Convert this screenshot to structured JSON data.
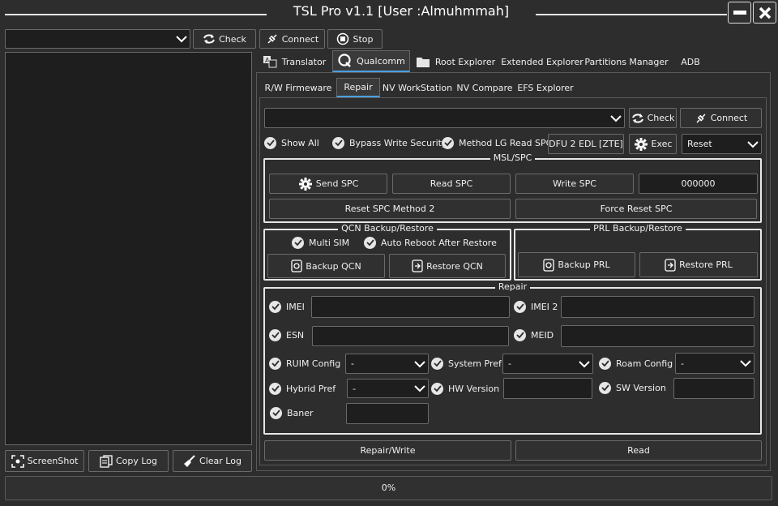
{
  "window": {
    "title": "TSL Pro v1.1 [User :Almuhmmah]"
  },
  "toolbar": {
    "check": "Check",
    "connect": "Connect",
    "stop": "Stop"
  },
  "log": {
    "screenshot": "ScreenShot",
    "copy": "Copy Log",
    "clear": "Clear Log"
  },
  "main_tabs": [
    "Translator",
    "Qualcomm",
    "Root Explorer",
    "Extended Explorer",
    "Partitions Manager",
    "ADB"
  ],
  "sub_tabs": [
    "R/W Firmeware",
    "Repair",
    "NV WorkStation",
    "NV Compare",
    "EFS Explorer"
  ],
  "repair": {
    "check": "Check",
    "connect": "Connect",
    "show_all": "Show All",
    "bypass": "Bypass Write Security",
    "method_lg": "Method LG Read SPC",
    "dfu": "DFU 2 EDL [ZTE]",
    "exec": "Exec",
    "reset_value": "Reset"
  },
  "msl": {
    "title": "MSL/SPC",
    "send": "Send SPC",
    "read": "Read SPC",
    "write": "Write SPC",
    "code": "000000",
    "reset_m2": "Reset SPC Method 2",
    "force_reset": "Force Reset SPC"
  },
  "qcn": {
    "title": "QCN Backup/Restore",
    "multi_sim": "Multi SIM",
    "auto_reboot": "Auto Reboot After Restore",
    "backup": "Backup QCN",
    "restore": "Restore QCN"
  },
  "prl": {
    "title": "PRL Backup/Restore",
    "backup": "Backup PRL",
    "restore": "Restore PRL"
  },
  "rep": {
    "title": "Repair",
    "imei": "IMEI",
    "imei2": "IMEI 2",
    "esn": "ESN",
    "meid": "MEID",
    "ruim": "RUIM Config",
    "ruim_val": "-",
    "system_pref": "System Pref",
    "system_val": "-",
    "roam": "Roam Config",
    "roam_val": "-",
    "hybrid": "Hybrid Pref",
    "hybrid_val": "-",
    "hw": "HW Version",
    "sw": "SW Version",
    "baner": "Baner"
  },
  "actions": {
    "repair_write": "Repair/Write",
    "read": "Read"
  },
  "progress": {
    "text": "0%",
    "value": 0
  }
}
